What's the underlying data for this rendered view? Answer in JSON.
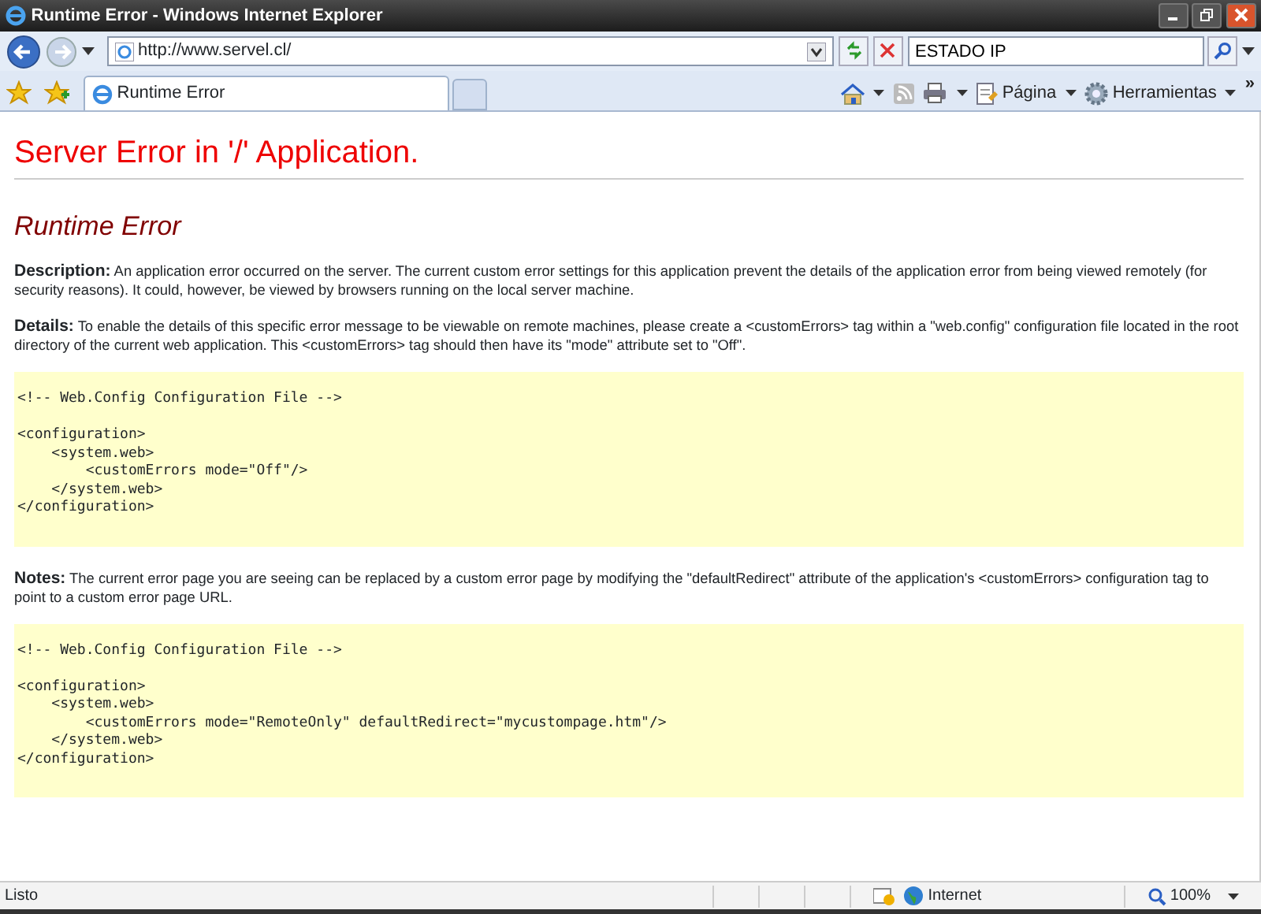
{
  "window": {
    "title": "Runtime Error - Windows Internet Explorer"
  },
  "address_bar": {
    "url": "http://www.servel.cl/"
  },
  "search": {
    "value": "ESTADO IP"
  },
  "tabs": [
    {
      "label": "Runtime Error",
      "selected": true
    }
  ],
  "command_bar": {
    "items": [
      {
        "kind": "home"
      },
      {
        "kind": "feeds"
      },
      {
        "kind": "print"
      },
      {
        "kind": "page",
        "label": "Página"
      },
      {
        "kind": "tools",
        "label": "Herramientas"
      }
    ],
    "overflow": "»"
  },
  "page": {
    "heading": "Server Error in '/' Application.",
    "subheading": "Runtime Error",
    "sections": [
      {
        "kind": "text",
        "text": "**Description:** An application error occurred on the server. The current custom error settings for this application prevent the details of the application error from being viewed remotely (for security reasons). It could, however, be viewed by browsers running on the local server machine."
      },
      {
        "kind": "text",
        "text": "**Details:** To enable the details of this specific error message to be viewable on remote machines, please create a <customErrors> tag within a \"web.config\" configuration file located in the root directory of the current web application. This <customErrors> tag should then have its \"mode\" attribute set to \"Off\"."
      },
      {
        "kind": "code",
        "comment": "<!-- Web.Config Configuration File -->",
        "lines": [
          "<configuration>",
          "    <system.web>",
          "        <customErrors mode=\"Off\"/>",
          "    </system.web>",
          "</configuration>"
        ]
      },
      {
        "kind": "text",
        "text": "**Notes:** The current error page you are seeing can be replaced by a custom error page by modifying the \"defaultRedirect\" attribute of the application's <customErrors> configuration tag to point to a custom error page URL."
      },
      {
        "kind": "code",
        "comment": "<!-- Web.Config Configuration File -->",
        "lines": [
          "<configuration>",
          "    <system.web>",
          "        <customErrors mode=\"RemoteOnly\" defaultRedirect=\"mycustompage.htm\"/>",
          "    </system.web>",
          "</configuration>"
        ]
      }
    ]
  },
  "status_bar": {
    "status": "Listo",
    "zone": "Internet",
    "zoom": "100%"
  }
}
